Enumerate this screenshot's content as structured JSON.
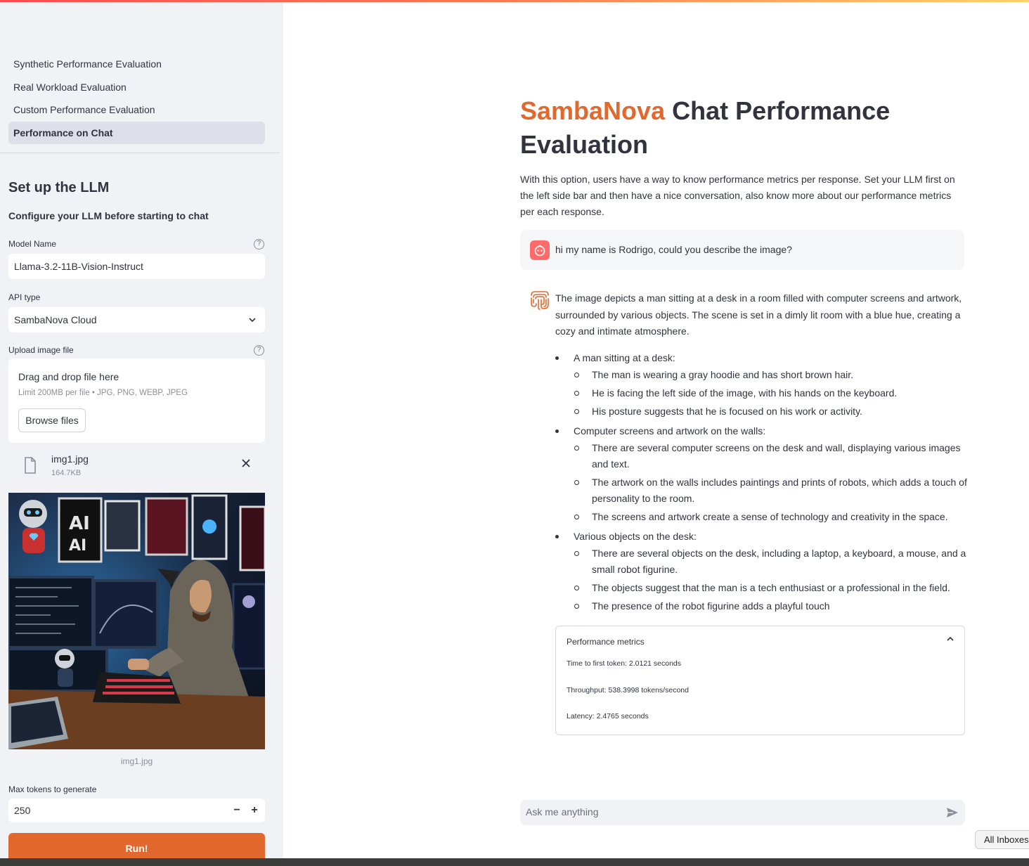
{
  "sidebar": {
    "nav": [
      {
        "label": "Synthetic Performance Evaluation",
        "active": false
      },
      {
        "label": "Real Workload Evaluation",
        "active": false
      },
      {
        "label": "Custom Performance Evaluation",
        "active": false
      },
      {
        "label": "Performance on Chat",
        "active": true
      }
    ],
    "heading": "Set up the LLM",
    "subheading": "Configure your LLM before starting to chat",
    "model_name": {
      "label": "Model Name",
      "value": "Llama-3.2-11B-Vision-Instruct"
    },
    "api_type": {
      "label": "API type",
      "value": "SambaNova Cloud"
    },
    "upload": {
      "label": "Upload image file",
      "dropzone_title": "Drag and drop file here",
      "limit": "Limit 200MB per file • JPG, PNG, WEBP, JPEG",
      "browse_label": "Browse files",
      "file_name": "img1.jpg",
      "file_size": "164.7KB",
      "caption": "img1.jpg"
    },
    "max_tokens": {
      "label": "Max tokens to generate",
      "value": "250",
      "minus": "−",
      "plus": "+"
    },
    "run_label": "Run!"
  },
  "main": {
    "title_brand": "SambaNova",
    "title_rest": " Chat Performance Evaluation",
    "intro": "With this option, users have a way to know performance metrics per response. Set your LLM first on the left side bar and then have a nice conversation, also know more about our performance metrics per each response.",
    "user_message": "hi my name is Rodrigo, could you describe the image?",
    "assistant_paragraph": "The image depicts a man sitting at a desk in a room filled with computer screens and artwork, surrounded by various objects. The scene is set in a dimly lit room with a blue hue, creating a cozy and intimate atmosphere.",
    "assistant_list": [
      {
        "title": "A man sitting at a desk:",
        "items": [
          "The man is wearing a gray hoodie and has short brown hair.",
          "He is facing the left side of the image, with his hands on the keyboard.",
          "His posture suggests that he is focused on his work or activity."
        ]
      },
      {
        "title": "Computer screens and artwork on the walls:",
        "items": [
          "There are several computer screens on the desk and wall, displaying various images and text.",
          "The artwork on the walls includes paintings and prints of robots, which adds a touch of personality to the room.",
          "The screens and artwork create a sense of technology and creativity in the space."
        ]
      },
      {
        "title": "Various objects on the desk:",
        "items": [
          "There are several objects on the desk, including a laptop, a keyboard, a mouse, and a small robot figurine.",
          "The objects suggest that the man is a tech enthusiast or a professional in the field.",
          "The presence of the robot figurine adds a playful touch"
        ]
      }
    ],
    "metrics": {
      "title": "Performance metrics",
      "ttft": "Time to first token: 2.0121 seconds",
      "throughput": "Throughput: 538.3998 tokens/second",
      "latency": "Latency: 2.4765 seconds"
    },
    "chat_placeholder": "Ask me anything",
    "inbox_label": "All Inboxes"
  },
  "colors": {
    "brand": "#e2692e",
    "sidebar_bg": "#f0f2f6",
    "user_avatar": "#ff6b6b"
  },
  "icons": [
    "help-icon",
    "chevron-down-icon",
    "file-icon",
    "close-icon",
    "user-avatar-icon",
    "sambanova-logo-icon",
    "chevron-up-icon",
    "send-icon"
  ]
}
